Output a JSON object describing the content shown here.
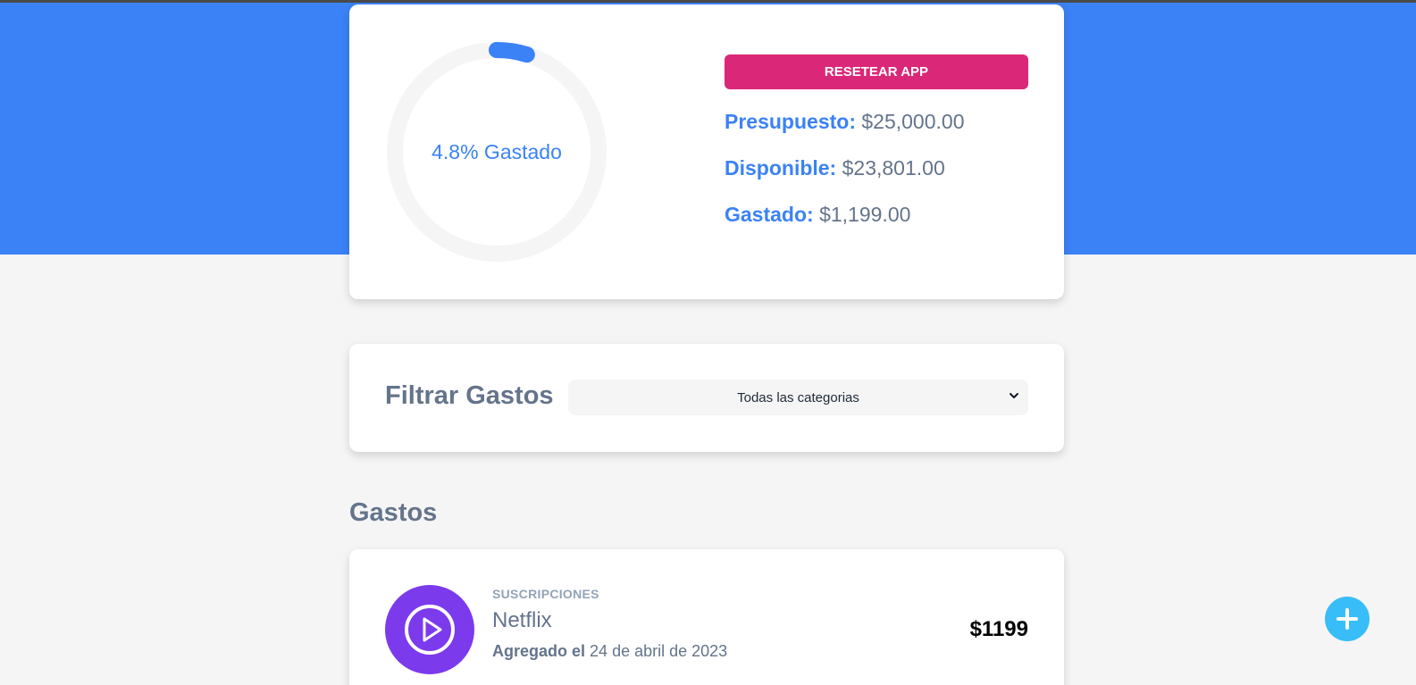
{
  "colors": {
    "primary": "#3b82f6",
    "danger": "#db2777",
    "subscription_icon_bg": "#7c3aed",
    "fab": "#38bdf8",
    "ring_track": "#f5f5f5"
  },
  "budget": {
    "percent_spent": 4.8,
    "ring_label": "4.8% Gastado",
    "reset_label": "RESETEAR APP",
    "presupuesto_label": "Presupuesto:",
    "presupuesto_value": "$25,000.00",
    "disponible_label": "Disponible:",
    "disponible_value": "$23,801.00",
    "gastado_label": "Gastado:",
    "gastado_value": "$1,199.00"
  },
  "filter": {
    "title": "Filtrar Gastos",
    "selected_option": "Todas las categorias",
    "icon": "chevron-down-icon"
  },
  "expenses": {
    "title": "Gastos",
    "items": [
      {
        "category": "SUSCRIPCIONES",
        "name": "Netflix",
        "date_label": "Agregado el",
        "date_value": "24 de abril de 2023",
        "amount": "$1199",
        "icon": "play-icon"
      }
    ]
  },
  "fab": {
    "icon": "plus-icon"
  }
}
